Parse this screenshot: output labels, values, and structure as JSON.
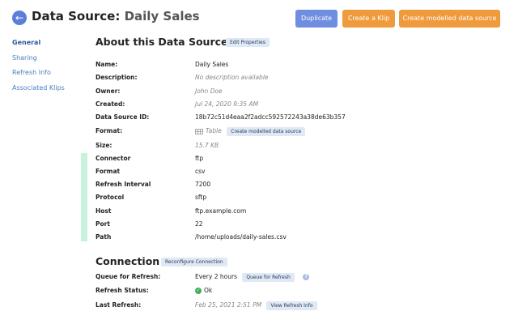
{
  "header": {
    "title_prefix": "Data Source:",
    "title_name": "Daily Sales",
    "back_icon": "arrow-left-icon",
    "buttons": {
      "duplicate": "Duplicate",
      "create_klip": "Create a Klip",
      "create_model": "Create modelled data source"
    }
  },
  "sidebar": {
    "items": [
      {
        "label": "General",
        "active": true
      },
      {
        "label": "Sharing"
      },
      {
        "label": "Refresh Info"
      },
      {
        "label": "Associated Klips"
      }
    ]
  },
  "about": {
    "title": "About this Data Source",
    "edit_label": "Edit Properties",
    "rows": {
      "name": {
        "label": "Name:",
        "value": "Daily Sales"
      },
      "description": {
        "label": "Description:",
        "value": "No description available"
      },
      "owner": {
        "label": "Owner:",
        "value": "John Doe"
      },
      "created": {
        "label": "Created:",
        "value": "Jul 24, 2020 9:35 AM"
      },
      "id": {
        "label": "Data Source ID:",
        "value": "18b72c51d4eaa2f2adcc592572243a38de63b357"
      },
      "format": {
        "label": "Format:",
        "value": "Table",
        "action": "Create modelled data source"
      },
      "size": {
        "label": "Size:",
        "value": "15.7 KB"
      }
    }
  },
  "connector": {
    "rows": [
      {
        "label": "Connector",
        "value": "ftp"
      },
      {
        "label": "Format",
        "value": "csv"
      },
      {
        "label": "Refresh Interval",
        "value": "7200"
      },
      {
        "label": "Protocol",
        "value": "sftp"
      },
      {
        "label": "Host",
        "value": "ftp.example.com"
      },
      {
        "label": "Port",
        "value": "22"
      },
      {
        "label": "Path",
        "value": "/home/uploads/daily-sales.csv"
      }
    ]
  },
  "connection": {
    "title": "Connection",
    "reconfigure_label": "Reconfigure Connection",
    "queue": {
      "label": "Queue for Refresh:",
      "value": "Every 2 hours",
      "button": "Queue for Refresh",
      "help_icon": "?"
    },
    "status": {
      "label": "Refresh Status:",
      "value": "Ok"
    },
    "last": {
      "label": "Last Refresh:",
      "value": "Feb 25, 2021 2:51 PM",
      "button": "View Refresh Info"
    }
  },
  "colors": {
    "accent_blue": "#6f8edf",
    "accent_orange": "#ef9a3c",
    "link": "#4a7fc1",
    "status_ok": "#3fae5a"
  }
}
